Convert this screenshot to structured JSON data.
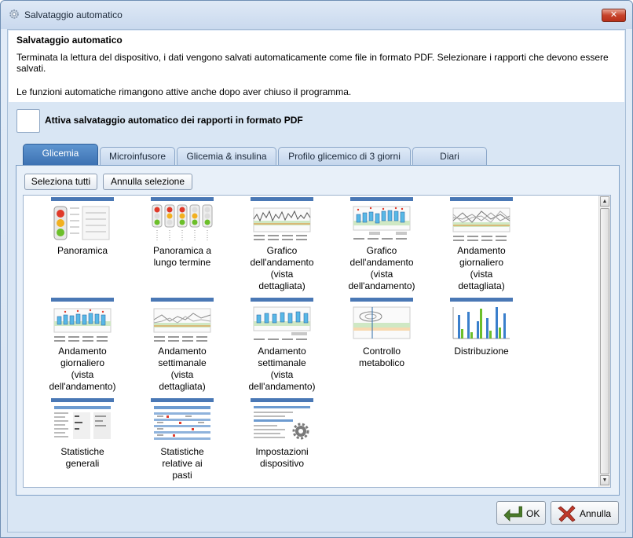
{
  "window": {
    "title": "Salvataggio automatico",
    "close_label": "✕"
  },
  "header": {
    "title": "Salvataggio automatico",
    "description": "Terminata la lettura del dispositivo, i dati vengono salvati automaticamente come file in formato PDF. Selezionare i rapporti che devono essere salvati.",
    "note": "Le funzioni automatiche rimangono attive anche dopo aver chiuso il programma."
  },
  "auto_save": {
    "label": "Attiva salvataggio automatico dei rapporti in formato PDF",
    "checked": false
  },
  "tabs": [
    {
      "label": "Glicemia",
      "active": true
    },
    {
      "label": "Microinfusore",
      "active": false
    },
    {
      "label": "Glicemia & insulina",
      "active": false
    },
    {
      "label": "Profilo glicemico di 3 giorni",
      "active": false
    },
    {
      "label": "Diari",
      "active": false
    }
  ],
  "toolbar": {
    "select_all": "Seleziona tutti",
    "deselect": "Annulla selezione"
  },
  "reports": [
    {
      "label_lines": [
        "Panoramica"
      ],
      "icon": "traffic-light-overview"
    },
    {
      "label_lines": [
        "Panoramica a",
        "lungo termine"
      ],
      "icon": "traffic-lights-long-term"
    },
    {
      "label_lines": [
        "Grafico",
        "dell'andamento",
        "(vista",
        "dettagliata)"
      ],
      "icon": "line-trend-chart"
    },
    {
      "label_lines": [
        "Grafico",
        "dell'andamento",
        "(vista",
        "dell'andamento)"
      ],
      "icon": "boxplot-trend-chart"
    },
    {
      "label_lines": [
        "Andamento",
        "giornaliero",
        "(vista",
        "dettagliata)"
      ],
      "icon": "daily-lines-chart"
    },
    {
      "label_lines": [
        "Andamento",
        "giornaliero",
        "(vista",
        "dell'andamento)"
      ],
      "icon": "daily-boxplot-chart"
    },
    {
      "label_lines": [
        "Andamento",
        "settimanale",
        "(vista",
        "dettagliata)"
      ],
      "icon": "weekly-lines-chart"
    },
    {
      "label_lines": [
        "Andamento",
        "settimanale",
        "(vista",
        "dell'andamento)"
      ],
      "icon": "weekly-boxplot-chart"
    },
    {
      "label_lines": [
        "Controllo",
        "metabolico"
      ],
      "icon": "metabolic-control-chart"
    },
    {
      "label_lines": [
        "Distribuzione"
      ],
      "icon": "distribution-bars"
    },
    {
      "label_lines": [
        "Statistiche",
        "generali"
      ],
      "icon": "general-stats-table"
    },
    {
      "label_lines": [
        "Statistiche",
        "relative ai",
        "pasti"
      ],
      "icon": "meal-stats-table"
    },
    {
      "label_lines": [
        "Impostazioni",
        "dispositivo"
      ],
      "icon": "device-settings-table"
    }
  ],
  "buttons": {
    "ok": "OK",
    "cancel": "Annulla"
  },
  "colors": {
    "accent": "#3a6fb0",
    "cancel_icon": "#c0392b",
    "ok_icon": "#4a7a2a"
  }
}
